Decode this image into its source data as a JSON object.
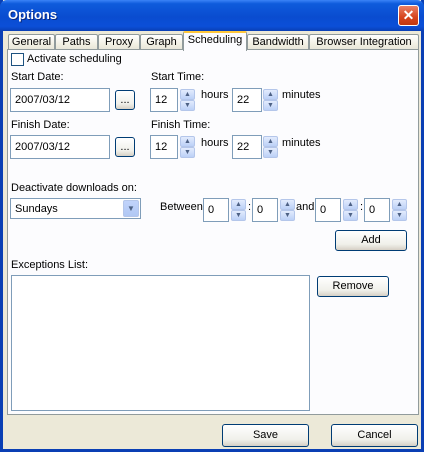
{
  "window": {
    "title": "Options"
  },
  "tabs": [
    "General",
    "Paths",
    "Proxy",
    "Graph",
    "Scheduling",
    "Bandwidth",
    "Browser Integration"
  ],
  "scheduling": {
    "activate_label": "Activate scheduling",
    "activate_checked": false,
    "start_date_label": "Start Date:",
    "start_date_value": "2007/03/12",
    "start_time_label": "Start Time:",
    "start_hours": "12",
    "start_minutes": "22",
    "finish_date_label": "Finish Date:",
    "finish_date_value": "2007/03/12",
    "finish_time_label": "Finish Time:",
    "finish_hours": "12",
    "finish_minutes": "22",
    "hours_label": "hours",
    "minutes_label": "minutes",
    "browse_label": "...",
    "deactivate_label": "Deactivate downloads on:",
    "deactivate_value": "Sundays",
    "between_label": "Between",
    "and_label": "and",
    "colon": ":",
    "from_h": "0",
    "from_m": "0",
    "to_h": "0",
    "to_m": "0",
    "add_label": "Add",
    "exceptions_label": "Exceptions List:",
    "remove_label": "Remove"
  },
  "footer": {
    "save_label": "Save",
    "cancel_label": "Cancel"
  },
  "icons": {
    "close": "close-icon",
    "spin_up": "spin-up-icon",
    "spin_down": "spin-down-icon",
    "dropdown": "chevron-down-icon"
  },
  "colors": {
    "titlebar": "#0a4cd0",
    "close": "#d6441d",
    "active_tab": "#ffc83c",
    "face": "#ece9d8"
  }
}
